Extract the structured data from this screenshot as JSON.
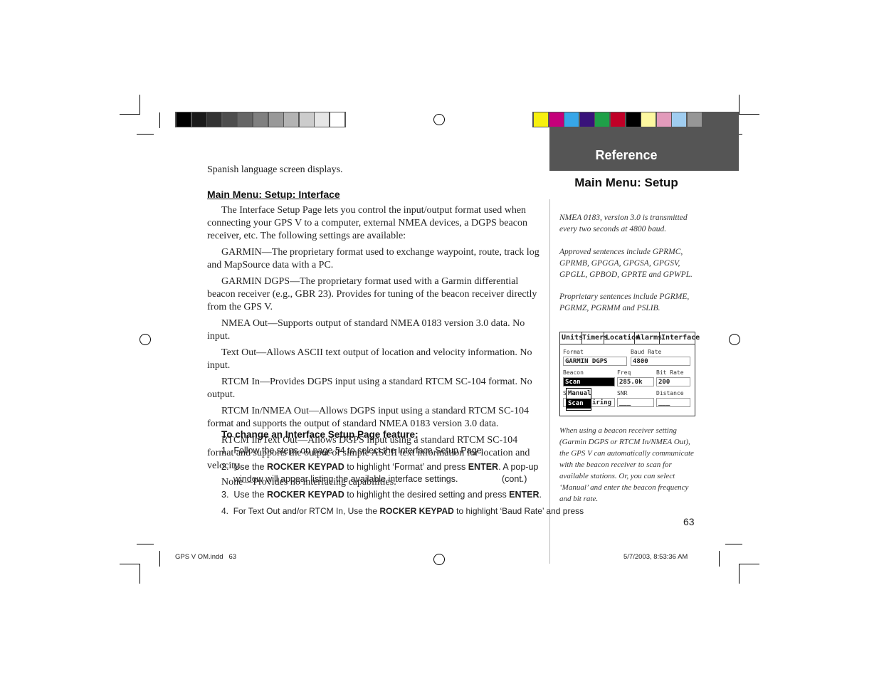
{
  "color_bar_gray": [
    "#000000",
    "#1a1a1a",
    "#333333",
    "#4d4d4d",
    "#666666",
    "#808080",
    "#999999",
    "#b3b3b3",
    "#cccccc",
    "#e6e6e6",
    "#ffffff"
  ],
  "color_bar_color": [
    "#f7f00f",
    "#c4007a",
    "#37a6e8",
    "#39137a",
    "#1fa048",
    "#c00027",
    "#000000",
    "#fdf8a0",
    "#e29bbb",
    "#a0cdf0",
    "#969696"
  ],
  "header": {
    "section": "Reference",
    "subtitle": "Main Menu: Setup"
  },
  "intro": "Spanish language screen displays.",
  "heading": "Main Menu: Setup: Interface",
  "paragraphs": [
    "The Interface Setup Page lets you control the input/output format used when connecting your GPS V to a computer, external NMEA devices, a DGPS beacon receiver, etc. The following settings are available:",
    "GARMIN—The proprietary format used to exchange waypoint, route, track log and MapSource data with a PC.",
    "GARMIN DGPS—The proprietary format used with a Garmin differential beacon receiver (e.g., GBR 23). Provides for tuning of the beacon receiver directly from the GPS V.",
    "NMEA Out—Supports output of standard NMEA 0183 version 3.0 data. No input.",
    "Text Out—Allows ASCII text output of location and velocity information. No input.",
    "RTCM In—Provides DGPS input using a standard RTCM SC-104 format. No output.",
    "RTCM In/NMEA Out—Allows DGPS input using a standard RTCM SC-104 format and supports the output of standard NMEA 0183 version 3.0 data.",
    "RTCM In/Text Out—Allows DGPS input using a standard RTCM SC-104 format and supports the output of simple ASCII text information for location and velocity.",
    "None—Provides no interfacing capabilities."
  ],
  "procedure_heading": "To change an Interface Setup Page feature:",
  "steps": [
    {
      "num": "1.",
      "pre": "Follow the steps on page 54 to select the Interface Setup Page."
    },
    {
      "num": "2.",
      "pre": "Use the ",
      "b1": "ROCKER KEYPAD",
      "mid": " to highlight ‘Format’ and press ",
      "b2": "ENTER",
      "post": ". A pop-up window will appear listing the available interface settings.",
      "cont": "(cont.)"
    },
    {
      "num": "3.",
      "pre": "Use the ",
      "b1": "ROCKER KEYPAD",
      "mid": " to highlight the desired setting and press ",
      "b2": "ENTER",
      "post": "."
    },
    {
      "num": "4.",
      "pre": "For Text Out and/or RTCM In, Use the ",
      "b1": "ROCKER KEYPAD",
      "mid": " to highlight ‘Baud Rate’ and press"
    }
  ],
  "sidebar_notes": [
    "NMEA 0183, version 3.0 is transmitted every two seconds at 4800 baud.",
    "Approved sentences include GPRMC, GPRMB, GPGGA, GPGSA, GPGSV, GPGLL, GPBOD, GPRTE and GPWPL.",
    "Proprietary sentences include PGRME, PGRMZ, PGRMM and PSLIB."
  ],
  "gps_screen": {
    "tabs": [
      "Units",
      "Timers",
      "Location",
      "Alarms",
      "Interface"
    ],
    "format_label": "Format",
    "format_value": "GARMIN DGPS",
    "baud_label": "Baud Rate",
    "baud_value": "4800",
    "beacon_label": "Beacon",
    "beacon_value": "Scan",
    "freq_label": "Freq",
    "freq_value": "285.0k",
    "bitrate_label": "Bit Rate",
    "bitrate_value": "200",
    "status_label": "S",
    "status_value": "iring",
    "snr_label": "SNR",
    "snr_value": "___",
    "distance_label": "Distance",
    "distance_value": "___",
    "popup": [
      "Manual",
      "Scan"
    ]
  },
  "caption": "When using a beacon receiver setting (Garmin DGPS or RTCM In/NMEA Out), the GPS V can automatically communicate with the beacon receiver to scan for available stations. Or, you can select ‘Manual’ and enter the beacon frequency and bit rate.",
  "page_number": "63",
  "footer": {
    "file": "GPS V OM.indd   63",
    "date": "5/7/2003, 8:53:36 AM"
  }
}
